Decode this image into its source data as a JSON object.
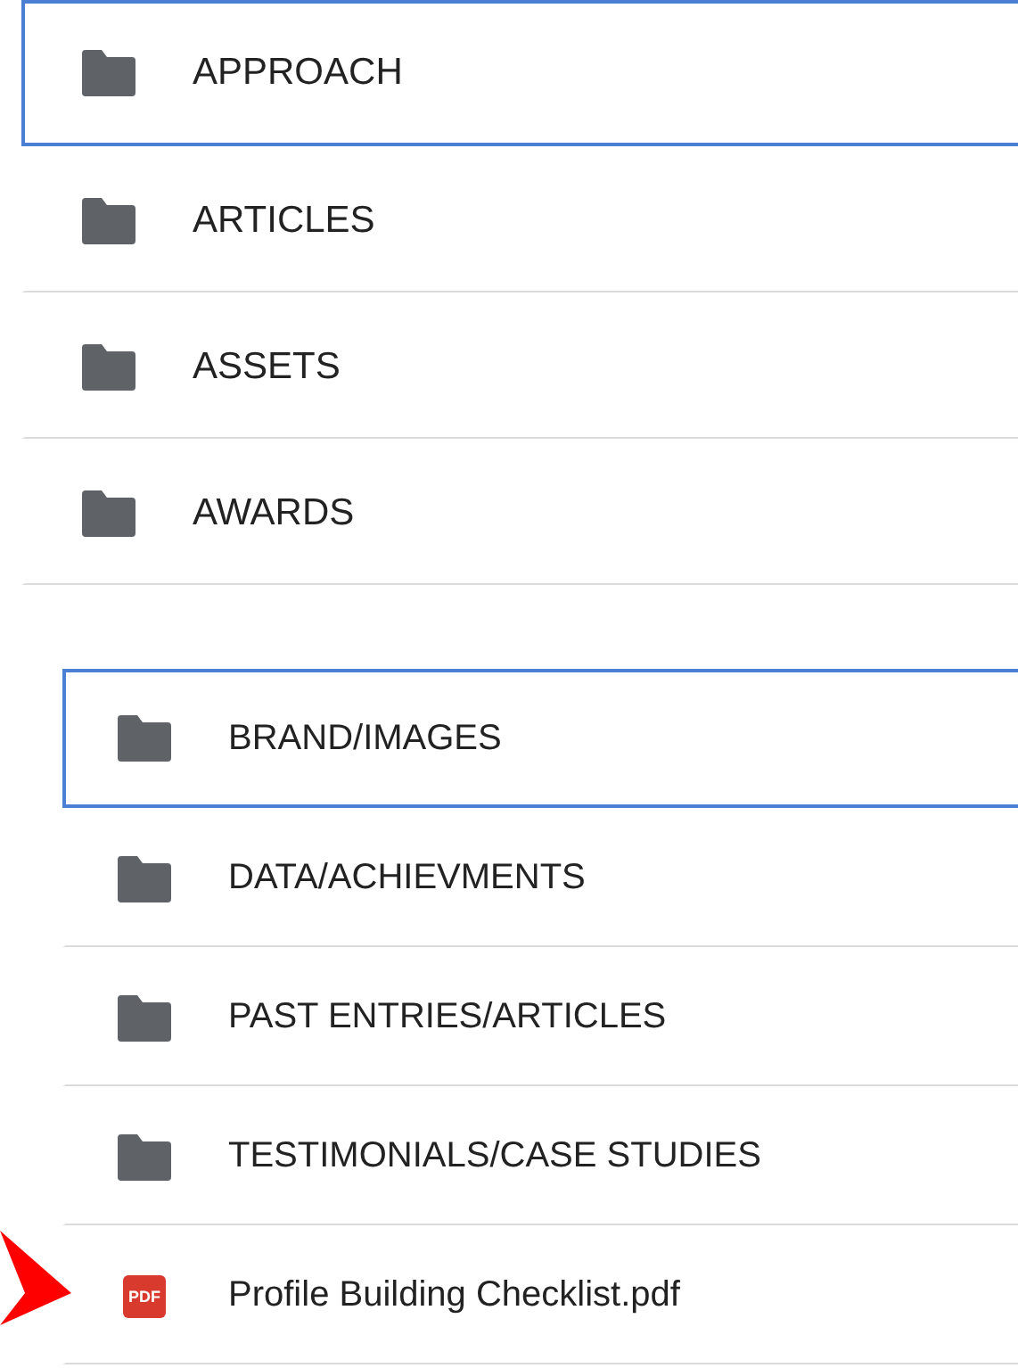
{
  "folder_lists": [
    {
      "items": [
        {
          "kind": "folder",
          "name": "APPROACH",
          "selected": true
        },
        {
          "kind": "folder",
          "name": "ARTICLES",
          "selected": false
        },
        {
          "kind": "folder",
          "name": "ASSETS",
          "selected": false
        },
        {
          "kind": "folder",
          "name": "AWARDS",
          "selected": false
        }
      ]
    },
    {
      "items": [
        {
          "kind": "folder",
          "name": "BRAND/IMAGES",
          "selected": true
        },
        {
          "kind": "folder",
          "name": "DATA/ACHIEVMENTS",
          "selected": false
        },
        {
          "kind": "folder",
          "name": "PAST ENTRIES/ARTICLES",
          "selected": false
        },
        {
          "kind": "folder",
          "name": "TESTIMONIALS/CASE STUDIES",
          "selected": false
        },
        {
          "kind": "pdf",
          "name": "Profile Building Checklist.pdf",
          "icon_label": "PDF",
          "selected": false
        }
      ]
    }
  ]
}
